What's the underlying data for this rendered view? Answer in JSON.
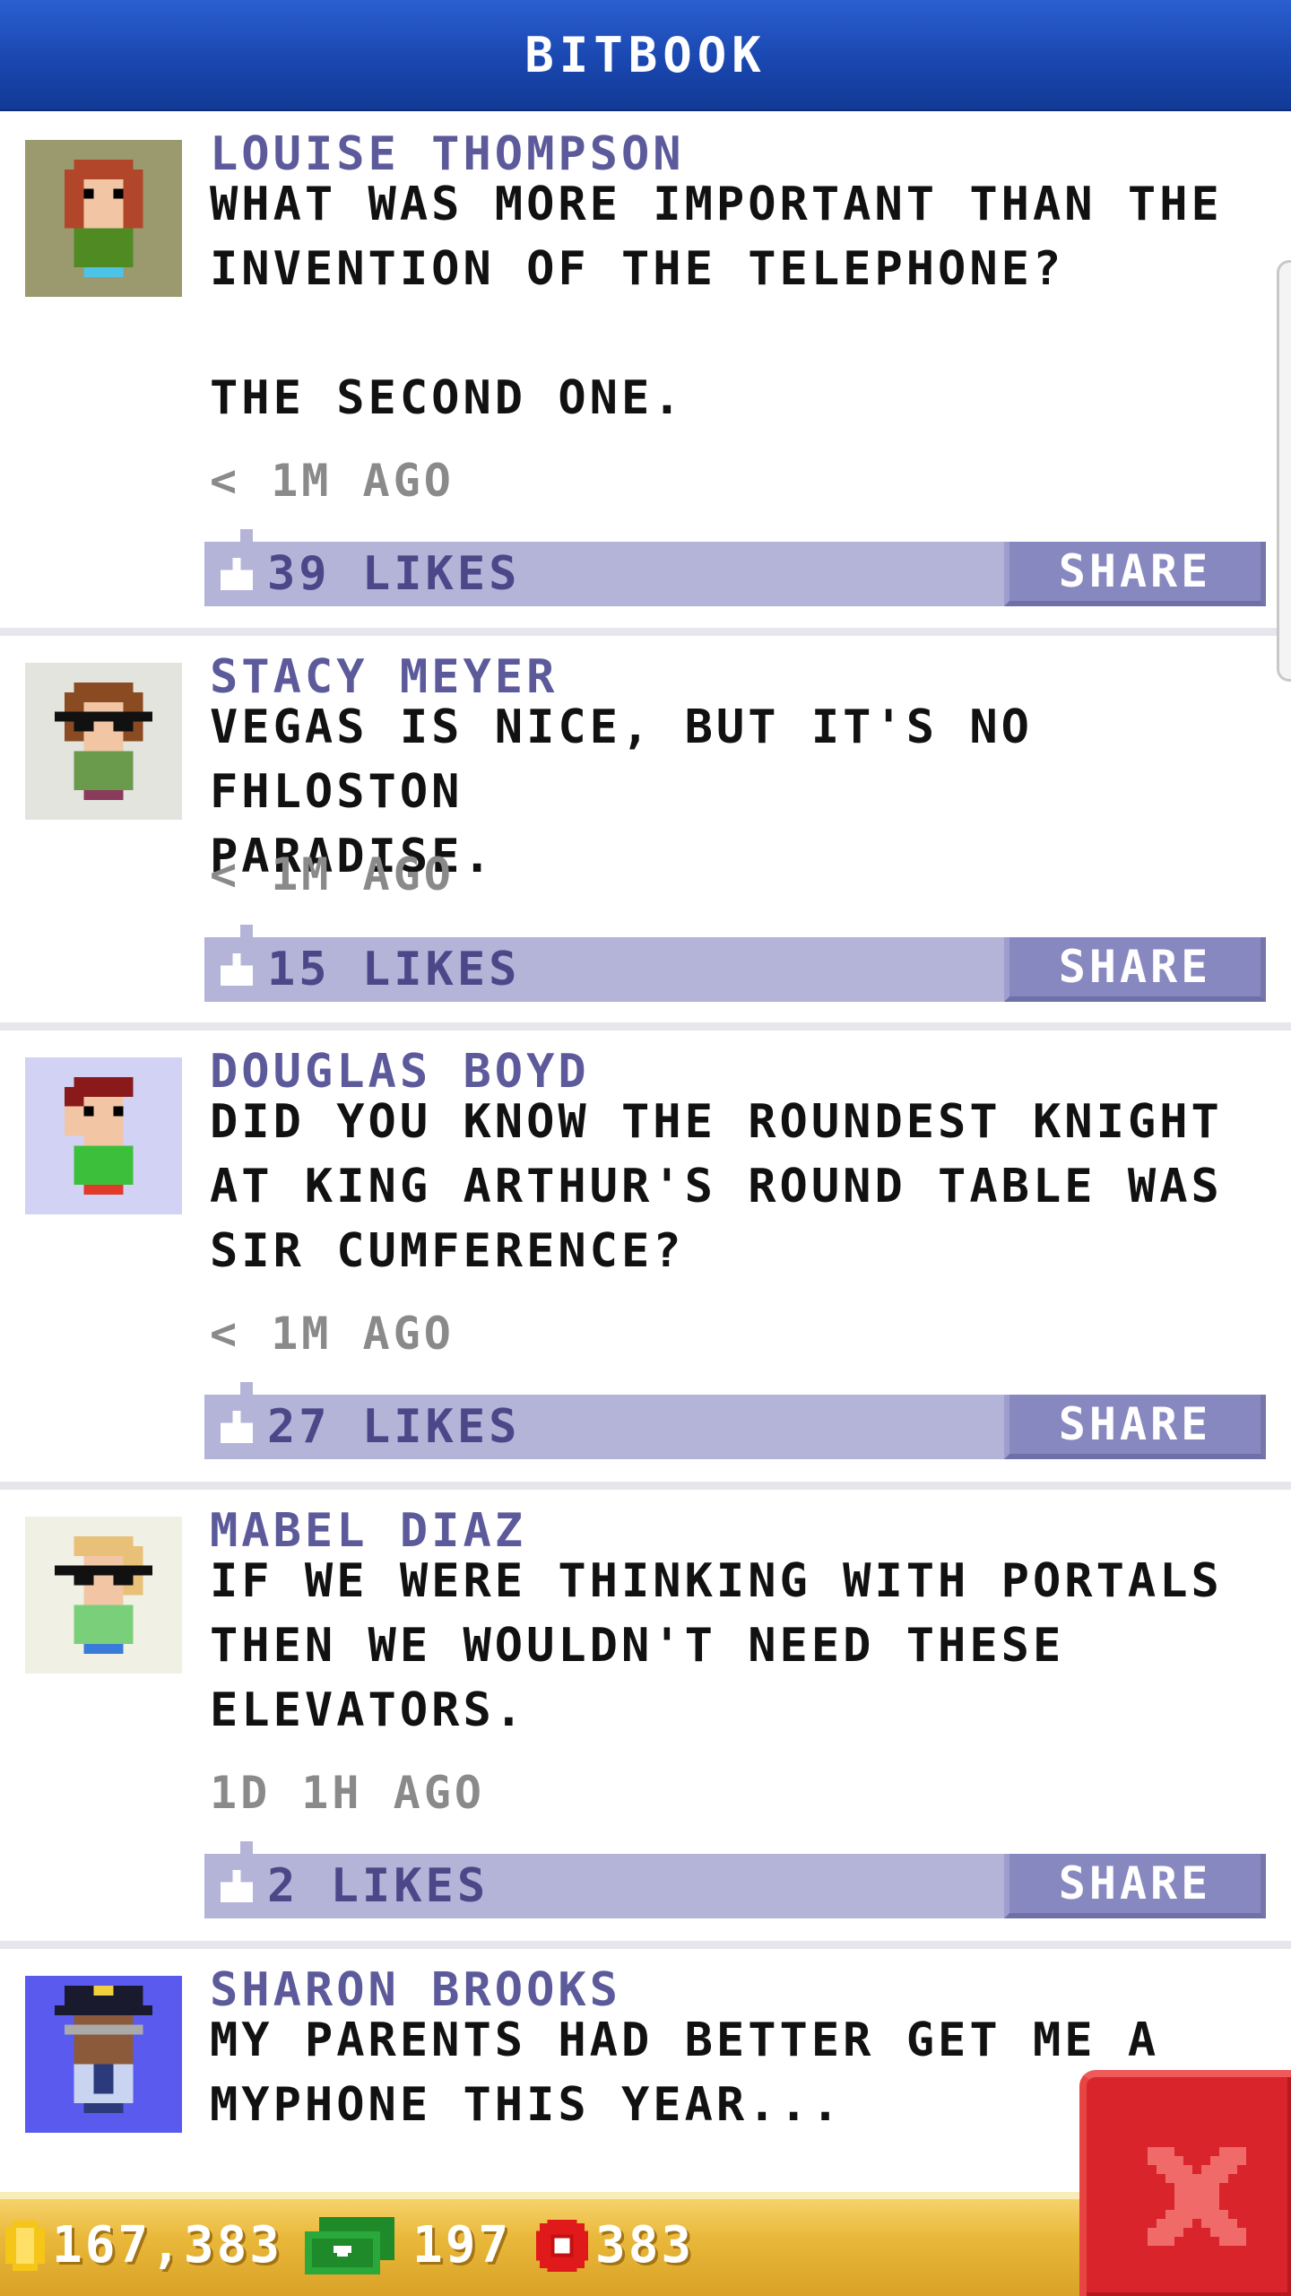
{
  "header": {
    "title": "BITBOOK"
  },
  "posts": [
    {
      "author": "LOUISE THOMPSON",
      "text": "WHAT WAS MORE IMPORTANT THAN THE\nINVENTION OF THE TELEPHONE?\n\nTHE SECOND ONE.",
      "time": "< 1M AGO",
      "likes": "39 LIKES",
      "share": "SHARE",
      "avatar_icon": "avatar-redhead-green-shirt-icon"
    },
    {
      "author": "STACY MEYER",
      "text": "VEGAS IS NICE, BUT IT'S NO FHLOSTON\nPARADISE.",
      "time": "< 1M AGO",
      "likes": "15 LIKES",
      "share": "SHARE",
      "avatar_icon": "avatar-glasses-brown-hair-icon"
    },
    {
      "author": "DOUGLAS BOYD",
      "text": "DID YOU KNOW THE ROUNDEST KNIGHT\nAT KING ARTHUR'S ROUND TABLE WAS\nSIR CUMFERENCE?",
      "time": "< 1M AGO",
      "likes": "27 LIKES",
      "share": "SHARE",
      "avatar_icon": "avatar-dark-red-hair-green-shirt-icon"
    },
    {
      "author": "MABEL DIAZ",
      "text": "IF WE WERE THINKING WITH PORTALS\nTHEN WE WOULDN'T NEED THESE\nELEVATORS.",
      "time": "1D 1H AGO",
      "likes": "2 LIKES",
      "share": "SHARE",
      "avatar_icon": "avatar-blonde-glasses-icon"
    },
    {
      "author": "SHARON BROOKS",
      "text": "MY PARENTS HAD BETTER GET ME A\nMYPHONE THIS YEAR...",
      "avatar_icon": "avatar-police-officer-icon"
    }
  ],
  "status": {
    "coins": "167,383",
    "cash": "197",
    "bux": "383"
  },
  "colors": {
    "header": "#1a47b0",
    "author": "#5c5a9a",
    "like_bar": "#b4b4d8",
    "share_button": "#8888c0",
    "bottom_bar": "#e9b83a",
    "close_button": "#d8242a"
  }
}
